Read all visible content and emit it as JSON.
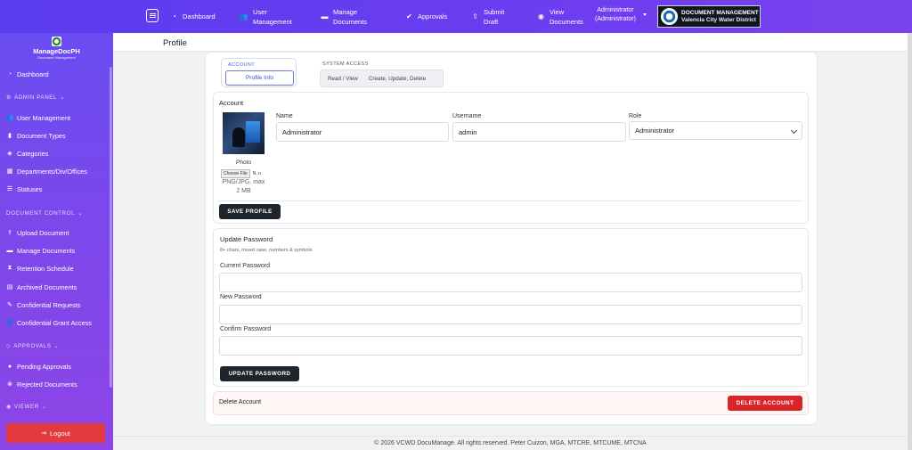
{
  "navbar": {
    "items": [
      {
        "label": "Dashboard",
        "icon": "gauge-icon"
      },
      {
        "label": "User Management",
        "icon": "users-icon"
      },
      {
        "label": "Manage Documents",
        "icon": "folder-icon"
      },
      {
        "label": "Approvals",
        "icon": "check-circle-icon"
      },
      {
        "label": "Submit Draft",
        "icon": "upload-icon"
      },
      {
        "label": "View Documents",
        "icon": "eye-icon"
      }
    ],
    "user_name": "Administrator",
    "user_role": "(Administrator)",
    "brand_line1": "DOCUMENT MANAGEMENT",
    "brand_line2": "Valencia City Water District"
  },
  "sidebar": {
    "brand_title": "ManageDocPH",
    "brand_subtitle": "Document Management",
    "dashboard": "Dashboard",
    "admin_panel": "ADMIN PANEL",
    "admin_items": [
      "User Management",
      "Document Types",
      "Categories",
      "Departments/Div/Offices",
      "Statuses"
    ],
    "document_control": "DOCUMENT CONTROL",
    "doc_items": [
      "Upload Document",
      "Manage Documents",
      "Retention Schedule",
      "Archived Documents",
      "Confidential Requests",
      "Confidential Grant Access"
    ],
    "approvals": "APPROVALS",
    "approval_items": [
      "Pending Approvals",
      "Rejected Documents"
    ],
    "viewer": "VIEWER",
    "logout": "Logout"
  },
  "page": {
    "title": "Profile"
  },
  "tabs": {
    "account_label": "ACCOUNT",
    "account_pill": "Profile Info",
    "system_label": "SYSTEM ACCESS",
    "system_read": "Read / View",
    "system_write": "Create, Update, Delete"
  },
  "account": {
    "title": "Account",
    "photo_label": "Photo",
    "choose_file": "Choose File",
    "no_file": "N..n",
    "file_hint": "PNG/JPG, max 2 MB",
    "name_label": "Name",
    "name_value": "Administrator",
    "username_label": "Username",
    "username_value": "admin",
    "role_label": "Role",
    "role_value": "Administrator",
    "save_button": "SAVE PROFILE"
  },
  "password": {
    "title": "Update Password",
    "hint": "8+ chars, mixed case, numbers & symbols",
    "current_label": "Current Password",
    "new_label": "New Password",
    "confirm_label": "Confirm Password",
    "update_button": "UPDATE PASSWORD"
  },
  "delete": {
    "title": "Delete Account",
    "button": "DELETE ACCOUNT"
  },
  "footer": {
    "text": "© 2026 VCWD DocuManage. All rights reserved. Peter Cuizon, MGA, MTCRE, MTCUME, MTCNA"
  },
  "colors": {
    "nav_gradient_start": "#5b3cf0",
    "sidebar_gradient_end": "#8d44e6",
    "danger": "#d9252a",
    "dark_button": "#1f252d",
    "accent_blue": "#3b4fcf"
  }
}
